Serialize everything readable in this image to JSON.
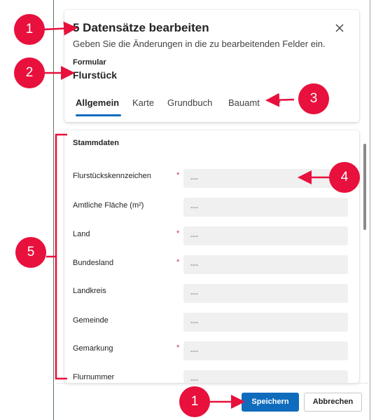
{
  "dialog": {
    "title": "5 Datensätze bearbeiten",
    "subtitle": "Geben Sie die Änderungen in die zu bearbeitenden Felder ein.",
    "form_label": "Formular",
    "form_value": "Flurstück"
  },
  "tabs": [
    {
      "label": "Allgemein",
      "active": true
    },
    {
      "label": "Karte"
    },
    {
      "label": "Grundbuch"
    },
    {
      "label": "Bauamt"
    }
  ],
  "tab_more": "...",
  "section": {
    "title": "Stammdaten"
  },
  "fields": [
    {
      "label": "Flurstückskennzeichen",
      "required": "*",
      "value": "---"
    },
    {
      "label": "Amtliche Fläche (m²)",
      "value": "---"
    },
    {
      "label": "Land",
      "required": "*",
      "value": "---"
    },
    {
      "label": "Bundesland",
      "required": "*",
      "value": "---"
    },
    {
      "label": "Landkreis",
      "value": "---"
    },
    {
      "label": "Gemeinde",
      "value": "---"
    },
    {
      "label": "Gemarkung",
      "required": "*",
      "value": "---"
    },
    {
      "label": "Flurnummer",
      "value": "---"
    }
  ],
  "buttons": {
    "save": "Speichern",
    "cancel": "Abbrechen"
  },
  "callouts": [
    "1",
    "2",
    "3",
    "4",
    "5",
    "1"
  ],
  "colors": {
    "primary": "#0f6cbd",
    "callout": "#e8103c",
    "required": "#c4314b",
    "input_bg": "#f0f0f0"
  },
  "icons": {
    "close": "close-icon"
  }
}
